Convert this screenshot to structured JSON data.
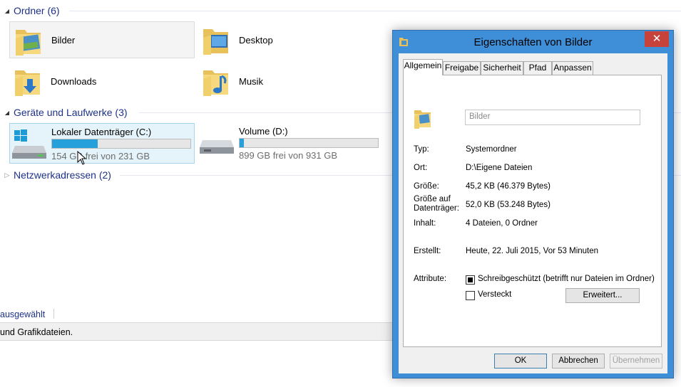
{
  "explorer": {
    "groups": {
      "folders": "Ordner (6)",
      "devices": "Geräte und Laufwerke (3)",
      "network": "Netzwerkadressen (2)"
    },
    "folders": [
      {
        "name": "Bilder"
      },
      {
        "name": "Desktop"
      },
      {
        "name": "Downloads"
      },
      {
        "name": "Musik"
      }
    ],
    "drives": [
      {
        "name": "Lokaler Datenträger (C:)",
        "free": "154 GB frei von 231 GB",
        "used_fraction": 0.33
      },
      {
        "name": "Volume (D:)",
        "free": "899 GB frei von 931 GB",
        "used_fraction": 0.03
      }
    ],
    "status_selected": "ausgewählt",
    "status_info": "und Grafikdateien."
  },
  "dialog": {
    "title": "Eigenschaften von Bilder",
    "close_label": "✕",
    "tabs": [
      "Allgemein",
      "Freigabe",
      "Sicherheit",
      "Pfad",
      "Anpassen"
    ],
    "name_value": "Bilder",
    "type_label": "Typ:",
    "type_value": "Systemordner",
    "location_label": "Ort:",
    "location_value": "D:\\Eigene Dateien",
    "size_label": "Größe:",
    "size_value": "45,2 KB (46.379 Bytes)",
    "size_disk_label_1": "Größe auf",
    "size_disk_label_2": "Datenträger:",
    "size_disk_value": "52,0 KB (53.248 Bytes)",
    "contents_label": "Inhalt:",
    "contents_value": "4 Dateien, 0 Ordner",
    "created_label": "Erstellt:",
    "created_value": "Heute, 22. Juli 2015, Vor 53 Minuten",
    "attributes_label": "Attribute:",
    "readonly_label": "Schreibgeschützt (betrifft nur Dateien im Ordner)",
    "hidden_label": "Versteckt",
    "advanced_button": "Erweitert...",
    "ok_button": "OK",
    "cancel_button": "Abbrechen",
    "apply_button": "Übernehmen"
  },
  "colors": {
    "accent": "#26a0da",
    "group_title": "#1e3287",
    "dialog_frame": "#3f8ed8",
    "close_button": "#c7423a"
  }
}
